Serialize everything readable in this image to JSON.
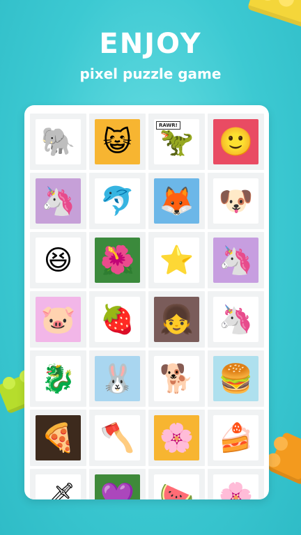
{
  "headline": "ENJOY",
  "subline": "pixel puzzle game",
  "colors": {
    "background": "#3cc9d2",
    "text": "#ffffff",
    "card": "#ffffff",
    "tile": "#f0f2f3"
  },
  "puzzles": [
    {
      "icon": "elephant-icon",
      "glyph": "🐘",
      "bg": "#ffffff"
    },
    {
      "icon": "cat-astronaut-icon",
      "glyph": "😺",
      "bg": "#f7b531"
    },
    {
      "icon": "dinosaur-icon",
      "glyph": "🦖",
      "bg": "#ffffff",
      "caption": "RAWR!"
    },
    {
      "icon": "rainbow-smiley-icon",
      "glyph": "🙂",
      "bg": "#e94b63"
    },
    {
      "icon": "unicorn-cat-icon",
      "glyph": "🦄",
      "bg": "#c6a0d8"
    },
    {
      "icon": "dolphin-icon",
      "glyph": "🐬",
      "bg": "#ffffff"
    },
    {
      "icon": "fox-icon",
      "glyph": "🦊",
      "bg": "#6cb7e8"
    },
    {
      "icon": "dog-face-icon",
      "glyph": "🐶",
      "bg": "#ffffff"
    },
    {
      "icon": "laughing-emoji-icon",
      "glyph": "😆",
      "bg": "#ffffff"
    },
    {
      "icon": "mandala-flower-icon",
      "glyph": "🌺",
      "bg": "#3b8a3c"
    },
    {
      "icon": "star-face-icon",
      "glyph": "⭐",
      "bg": "#ffffff"
    },
    {
      "icon": "unicorn-icon",
      "glyph": "🦄",
      "bg": "#c79ee0"
    },
    {
      "icon": "pig-face-icon",
      "glyph": "🐷",
      "bg": "#f2b6e8"
    },
    {
      "icon": "strawberry-icon",
      "glyph": "🍓",
      "bg": "#ffffff"
    },
    {
      "icon": "anime-girl-icon",
      "glyph": "👧",
      "bg": "#7a5c5a"
    },
    {
      "icon": "unicorn-plush-icon",
      "glyph": "🦄",
      "bg": "#ffffff"
    },
    {
      "icon": "baby-dragon-icon",
      "glyph": "🐉",
      "bg": "#ffffff"
    },
    {
      "icon": "bunny-icon",
      "glyph": "🐰",
      "bg": "#a9d6f0"
    },
    {
      "icon": "puppy-icon",
      "glyph": "🐕",
      "bg": "#ffffff"
    },
    {
      "icon": "burger-meal-icon",
      "glyph": "🍔",
      "bg": "#aee0ee"
    },
    {
      "icon": "pizza-icon",
      "glyph": "🍕",
      "bg": "#3d2a1d"
    },
    {
      "icon": "axe-icon",
      "glyph": "🪓",
      "bg": "#ffffff"
    },
    {
      "icon": "mandala-icon",
      "glyph": "🌸",
      "bg": "#f7b531"
    },
    {
      "icon": "cake-slice-icon",
      "glyph": "🍰",
      "bg": "#ffffff"
    },
    {
      "icon": "sword-icon",
      "glyph": "🗡",
      "bg": "#ffffff"
    },
    {
      "icon": "purple-gem-icon",
      "glyph": "💜",
      "bg": "#3f8a3a"
    },
    {
      "icon": "watermelon-icon",
      "glyph": "🍉",
      "bg": "#ffffff"
    },
    {
      "icon": "pink-flower-icon",
      "glyph": "🌸",
      "bg": "#ffffff"
    }
  ]
}
